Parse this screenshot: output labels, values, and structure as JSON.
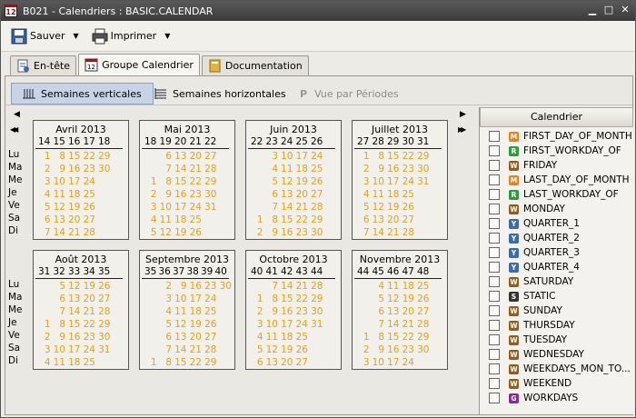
{
  "window": {
    "title": "B021 - Calendriers : BASIC.CALENDAR",
    "app_icon_label": "12"
  },
  "toolbar": {
    "save_label": "Sauver",
    "print_label": "Imprimer"
  },
  "tabs": [
    {
      "label": "En-tête",
      "icon": "header-doc-icon",
      "active": false
    },
    {
      "label": "Groupe Calendrier",
      "icon": "calendar-icon",
      "active": true
    },
    {
      "label": "Documentation",
      "icon": "book-icon",
      "active": false
    }
  ],
  "view_modes": [
    {
      "label": "Semaines verticales",
      "active": true,
      "enabled": true
    },
    {
      "label": "Semaines horizontales",
      "active": false,
      "enabled": true
    },
    {
      "label": "Vue par Périodes",
      "active": false,
      "enabled": false
    }
  ],
  "day_labels": [
    "Lu",
    "Ma",
    "Me",
    "Je",
    "Ve",
    "Sa",
    "Di"
  ],
  "months": [
    {
      "name": "Avril 2013",
      "weeks": [
        "14",
        "15",
        "16",
        "17",
        "18"
      ],
      "grid": [
        [
          "1",
          "8",
          "15",
          "22",
          "29"
        ],
        [
          "2",
          "9",
          "16",
          "23",
          "30"
        ],
        [
          "3",
          "10",
          "17",
          "24",
          ""
        ],
        [
          "4",
          "11",
          "18",
          "25",
          ""
        ],
        [
          "5",
          "12",
          "19",
          "26",
          ""
        ],
        [
          "6",
          "13",
          "20",
          "27",
          ""
        ],
        [
          "7",
          "14",
          "21",
          "28",
          ""
        ]
      ]
    },
    {
      "name": "Mai 2013",
      "weeks": [
        "18",
        "19",
        "20",
        "21",
        "22"
      ],
      "grid": [
        [
          "",
          "6",
          "13",
          "20",
          "27"
        ],
        [
          "",
          "7",
          "14",
          "21",
          "28"
        ],
        [
          "1",
          "8",
          "15",
          "22",
          "29"
        ],
        [
          "2",
          "9",
          "16",
          "23",
          "30"
        ],
        [
          "3",
          "10",
          "17",
          "24",
          "31"
        ],
        [
          "4",
          "11",
          "18",
          "25",
          ""
        ],
        [
          "5",
          "12",
          "19",
          "26",
          ""
        ]
      ]
    },
    {
      "name": "Juin 2013",
      "weeks": [
        "22",
        "23",
        "24",
        "25",
        "26"
      ],
      "grid": [
        [
          "",
          "3",
          "10",
          "17",
          "24"
        ],
        [
          "",
          "4",
          "11",
          "18",
          "25"
        ],
        [
          "",
          "5",
          "12",
          "19",
          "26"
        ],
        [
          "",
          "6",
          "13",
          "20",
          "27"
        ],
        [
          "",
          "7",
          "14",
          "21",
          "28"
        ],
        [
          "1",
          "8",
          "15",
          "22",
          "29"
        ],
        [
          "2",
          "9",
          "16",
          "23",
          "30"
        ]
      ]
    },
    {
      "name": "Juillet 2013",
      "weeks": [
        "27",
        "28",
        "29",
        "30",
        "31"
      ],
      "grid": [
        [
          "1",
          "8",
          "15",
          "22",
          "29"
        ],
        [
          "2",
          "9",
          "16",
          "23",
          "30"
        ],
        [
          "3",
          "10",
          "17",
          "24",
          "31"
        ],
        [
          "4",
          "11",
          "18",
          "25",
          ""
        ],
        [
          "5",
          "12",
          "19",
          "26",
          ""
        ],
        [
          "6",
          "13",
          "20",
          "27",
          ""
        ],
        [
          "7",
          "14",
          "21",
          "28",
          ""
        ]
      ]
    },
    {
      "name": "Août 2013",
      "weeks": [
        "31",
        "32",
        "33",
        "34",
        "35"
      ],
      "grid": [
        [
          "",
          "5",
          "12",
          "19",
          "26"
        ],
        [
          "",
          "6",
          "13",
          "20",
          "27"
        ],
        [
          "",
          "7",
          "14",
          "21",
          "28"
        ],
        [
          "1",
          "8",
          "15",
          "22",
          "29"
        ],
        [
          "2",
          "9",
          "16",
          "23",
          "30"
        ],
        [
          "3",
          "10",
          "17",
          "24",
          "31"
        ],
        [
          "4",
          "11",
          "18",
          "25",
          ""
        ]
      ]
    },
    {
      "name": "Septembre 2013",
      "weeks": [
        "35",
        "36",
        "37",
        "38",
        "39",
        "40"
      ],
      "grid": [
        [
          "",
          "2",
          "9",
          "16",
          "23",
          "30"
        ],
        [
          "",
          "3",
          "10",
          "17",
          "24",
          ""
        ],
        [
          "",
          "4",
          "11",
          "18",
          "25",
          ""
        ],
        [
          "",
          "5",
          "12",
          "19",
          "26",
          ""
        ],
        [
          "",
          "6",
          "13",
          "20",
          "27",
          ""
        ],
        [
          "",
          "7",
          "14",
          "21",
          "28",
          ""
        ],
        [
          "1",
          "8",
          "15",
          "22",
          "29",
          ""
        ]
      ]
    },
    {
      "name": "Octobre 2013",
      "weeks": [
        "40",
        "41",
        "42",
        "43",
        "44"
      ],
      "grid": [
        [
          "",
          "7",
          "14",
          "21",
          "28"
        ],
        [
          "1",
          "8",
          "15",
          "22",
          "29"
        ],
        [
          "2",
          "9",
          "16",
          "23",
          "30"
        ],
        [
          "3",
          "10",
          "17",
          "24",
          "31"
        ],
        [
          "4",
          "11",
          "18",
          "25",
          ""
        ],
        [
          "5",
          "12",
          "19",
          "26",
          ""
        ],
        [
          "6",
          "13",
          "20",
          "27",
          ""
        ]
      ]
    },
    {
      "name": "Novembre 2013",
      "weeks": [
        "44",
        "45",
        "46",
        "47",
        "48"
      ],
      "grid": [
        [
          "",
          "4",
          "11",
          "18",
          "25"
        ],
        [
          "",
          "5",
          "12",
          "19",
          "26"
        ],
        [
          "",
          "6",
          "13",
          "20",
          "27"
        ],
        [
          "",
          "7",
          "14",
          "21",
          "28"
        ],
        [
          "1",
          "8",
          "15",
          "22",
          "29"
        ],
        [
          "2",
          "9",
          "16",
          "23",
          "30"
        ],
        [
          "3",
          "10",
          "17",
          "24",
          ""
        ]
      ]
    }
  ],
  "calendar_panel": {
    "header": "Calendrier",
    "items": [
      {
        "name": "FIRST_DAY_OF_MONTH",
        "badge": "M",
        "color": "#e8821e"
      },
      {
        "name": "FIRST_WORKDAY_OF",
        "badge": "R",
        "color": "#2e9a3a"
      },
      {
        "name": "FRIDAY",
        "badge": "W",
        "color": "#9a5a12"
      },
      {
        "name": "LAST_DAY_OF_MONTH",
        "badge": "M",
        "color": "#e8821e"
      },
      {
        "name": "LAST_WORKDAY_OF",
        "badge": "R",
        "color": "#2e9a3a"
      },
      {
        "name": "MONDAY",
        "badge": "W",
        "color": "#9a5a12"
      },
      {
        "name": "QUARTER_1",
        "badge": "Y",
        "color": "#3a6ab0"
      },
      {
        "name": "QUARTER_2",
        "badge": "Y",
        "color": "#3a6ab0"
      },
      {
        "name": "QUARTER_3",
        "badge": "Y",
        "color": "#3a6ab0"
      },
      {
        "name": "QUARTER_4",
        "badge": "Y",
        "color": "#3a6ab0"
      },
      {
        "name": "SATURDAY",
        "badge": "W",
        "color": "#9a5a12"
      },
      {
        "name": "STATIC",
        "badge": "S",
        "color": "#333333"
      },
      {
        "name": "SUNDAY",
        "badge": "W",
        "color": "#9a5a12"
      },
      {
        "name": "THURSDAY",
        "badge": "W",
        "color": "#9a5a12"
      },
      {
        "name": "TUESDAY",
        "badge": "W",
        "color": "#9a5a12"
      },
      {
        "name": "WEDNESDAY",
        "badge": "W",
        "color": "#9a5a12"
      },
      {
        "name": "WEEKDAYS_MON_TO...",
        "badge": "W",
        "color": "#9a5a12"
      },
      {
        "name": "WEEKEND",
        "badge": "W",
        "color": "#9a5a12"
      },
      {
        "name": "WORKDAYS",
        "badge": "G",
        "color": "#8a2a9a"
      }
    ]
  },
  "nav": {
    "prev_one": "◀",
    "prev_all": "◀◀",
    "next_one": "▶",
    "next_all": "▶▶"
  }
}
